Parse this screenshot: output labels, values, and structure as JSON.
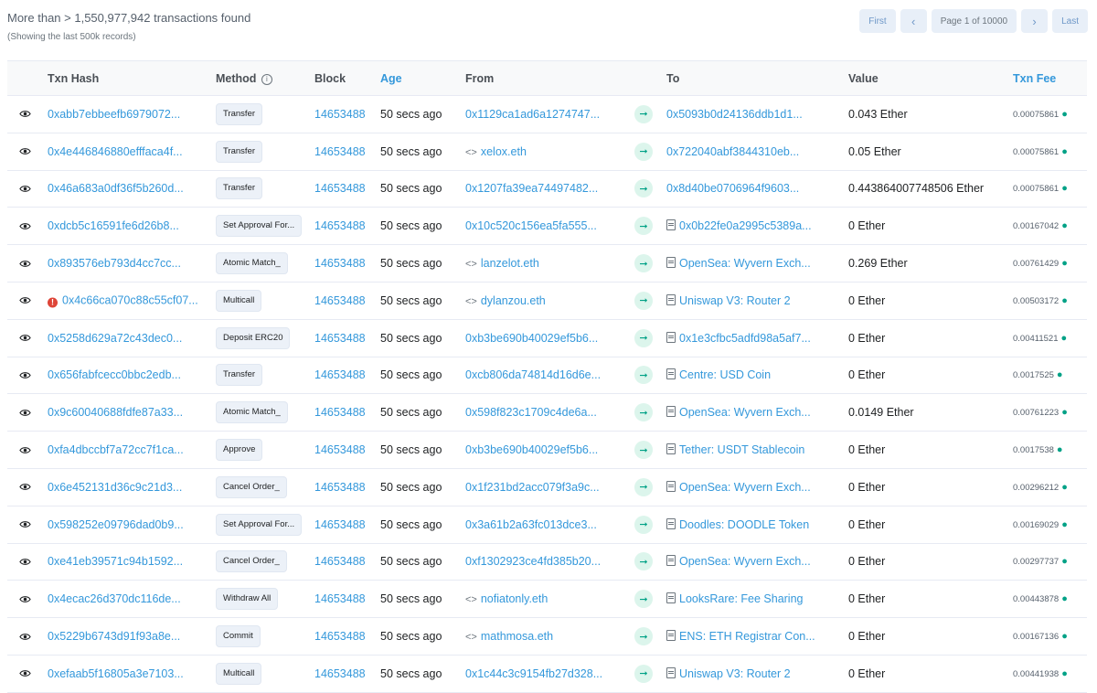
{
  "summary": {
    "text": "More than > 1,550,977,942 transactions found",
    "subtext": "(Showing the last 500k records)"
  },
  "pager": {
    "first": "First",
    "prev": "‹",
    "page": "Page 1 of 10000",
    "next": "›",
    "last": "Last"
  },
  "columns": {
    "hash": "Txn Hash",
    "method": "Method",
    "block": "Block",
    "age": "Age",
    "from": "From",
    "to": "To",
    "value": "Value",
    "fee": "Txn Fee"
  },
  "rows": [
    {
      "hash": "0xabb7ebbeefb6979072...",
      "method": "Transfer",
      "block": "14653488",
      "age": "50 secs ago",
      "from": "0x1129ca1ad6a1274747...",
      "from_type": "addr",
      "to": "0x5093b0d24136ddb1d1...",
      "to_type": "addr",
      "value": "0.043 Ether",
      "fee": "0.00075861",
      "error": false
    },
    {
      "hash": "0x4e446846880efffaca4f...",
      "method": "Transfer",
      "block": "14653488",
      "age": "50 secs ago",
      "from": "xelox.eth",
      "from_type": "contract",
      "to": "0x722040abf3844310eb...",
      "to_type": "addr",
      "value": "0.05 Ether",
      "fee": "0.00075861",
      "error": false
    },
    {
      "hash": "0x46a683a0df36f5b260d...",
      "method": "Transfer",
      "block": "14653488",
      "age": "50 secs ago",
      "from": "0x1207fa39ea74497482...",
      "from_type": "addr",
      "to": "0x8d40be0706964f9603...",
      "to_type": "addr",
      "value": "0.443864007748506 Ether",
      "fee": "0.00075861",
      "error": false
    },
    {
      "hash": "0xdcb5c16591fe6d26b8...",
      "method": "Set Approval For...",
      "block": "14653488",
      "age": "50 secs ago",
      "from": "0x10c520c156ea5fa555...",
      "from_type": "addr",
      "to": "0x0b22fe0a2995c5389a...",
      "to_type": "doc",
      "value": "0 Ether",
      "fee": "0.00167042",
      "error": false
    },
    {
      "hash": "0x893576eb793d4cc7cc...",
      "method": "Atomic Match_",
      "block": "14653488",
      "age": "50 secs ago",
      "from": "lanzelot.eth",
      "from_type": "contract",
      "to": "OpenSea: Wyvern Exch...",
      "to_type": "doc",
      "value": "0.269 Ether",
      "fee": "0.00761429",
      "error": false
    },
    {
      "hash": "0x4c66ca070c88c55cf07...",
      "method": "Multicall",
      "block": "14653488",
      "age": "50 secs ago",
      "from": "dylanzou.eth",
      "from_type": "contract",
      "to": "Uniswap V3: Router 2",
      "to_type": "doc",
      "value": "0 Ether",
      "fee": "0.00503172",
      "error": true
    },
    {
      "hash": "0x5258d629a72c43dec0...",
      "method": "Deposit ERC20",
      "block": "14653488",
      "age": "50 secs ago",
      "from": "0xb3be690b40029ef5b6...",
      "from_type": "addr",
      "to": "0x1e3cfbc5adfd98a5af7...",
      "to_type": "doc",
      "value": "0 Ether",
      "fee": "0.00411521",
      "error": false
    },
    {
      "hash": "0x656fabfcecc0bbc2edb...",
      "method": "Transfer",
      "block": "14653488",
      "age": "50 secs ago",
      "from": "0xcb806da74814d16d6e...",
      "from_type": "addr",
      "to": "Centre: USD Coin",
      "to_type": "doc",
      "value": "0 Ether",
      "fee": "0.0017525",
      "error": false
    },
    {
      "hash": "0x9c60040688fdfe87a33...",
      "method": "Atomic Match_",
      "block": "14653488",
      "age": "50 secs ago",
      "from": "0x598f823c1709c4de6a...",
      "from_type": "addr",
      "to": "OpenSea: Wyvern Exch...",
      "to_type": "doc",
      "value": "0.0149 Ether",
      "fee": "0.00761223",
      "error": false
    },
    {
      "hash": "0xfa4dbccbf7a72cc7f1ca...",
      "method": "Approve",
      "block": "14653488",
      "age": "50 secs ago",
      "from": "0xb3be690b40029ef5b6...",
      "from_type": "addr",
      "to": "Tether: USDT Stablecoin",
      "to_type": "doc",
      "value": "0 Ether",
      "fee": "0.0017538",
      "error": false
    },
    {
      "hash": "0x6e452131d36c9c21d3...",
      "method": "Cancel Order_",
      "block": "14653488",
      "age": "50 secs ago",
      "from": "0x1f231bd2acc079f3a9c...",
      "from_type": "addr",
      "to": "OpenSea: Wyvern Exch...",
      "to_type": "doc",
      "value": "0 Ether",
      "fee": "0.00296212",
      "error": false
    },
    {
      "hash": "0x598252e09796dad0b9...",
      "method": "Set Approval For...",
      "block": "14653488",
      "age": "50 secs ago",
      "from": "0x3a61b2a63fc013dce3...",
      "from_type": "addr",
      "to": "Doodles: DOODLE Token",
      "to_type": "doc",
      "value": "0 Ether",
      "fee": "0.00169029",
      "error": false
    },
    {
      "hash": "0xe41eb39571c94b1592...",
      "method": "Cancel Order_",
      "block": "14653488",
      "age": "50 secs ago",
      "from": "0xf1302923ce4fd385b20...",
      "from_type": "addr",
      "to": "OpenSea: Wyvern Exch...",
      "to_type": "doc",
      "value": "0 Ether",
      "fee": "0.00297737",
      "error": false
    },
    {
      "hash": "0x4ecac26d370dc116de...",
      "method": "Withdraw All",
      "block": "14653488",
      "age": "50 secs ago",
      "from": "nofiatonly.eth",
      "from_type": "contract",
      "to": "LooksRare: Fee Sharing",
      "to_type": "doc",
      "value": "0 Ether",
      "fee": "0.00443878",
      "error": false
    },
    {
      "hash": "0x5229b6743d91f93a8e...",
      "method": "Commit",
      "block": "14653488",
      "age": "50 secs ago",
      "from": "mathmosa.eth",
      "from_type": "contract",
      "to": "ENS: ETH Registrar Con...",
      "to_type": "doc",
      "value": "0 Ether",
      "fee": "0.00167136",
      "error": false
    },
    {
      "hash": "0xefaab5f16805a3e7103...",
      "method": "Multicall",
      "block": "14653488",
      "age": "50 secs ago",
      "from": "0x1c44c3c9154fb27d328...",
      "from_type": "addr",
      "to": "Uniswap V3: Router 2",
      "to_type": "doc",
      "value": "0 Ether",
      "fee": "0.00441938",
      "error": false
    }
  ]
}
